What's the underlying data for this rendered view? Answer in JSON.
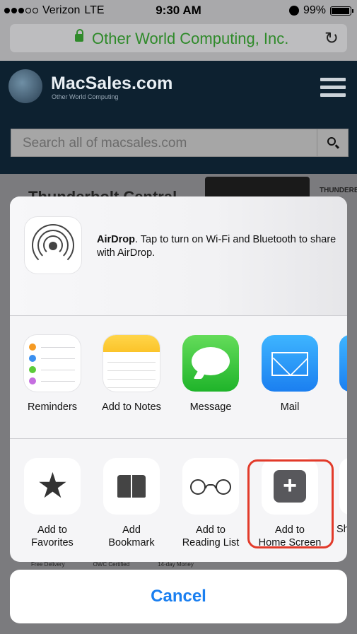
{
  "status_bar": {
    "carrier": "Verizon",
    "network": "LTE",
    "time": "9:30 AM",
    "battery": "99%",
    "battery_level": 0.99
  },
  "browser": {
    "url_title": "Other World Computing, Inc.",
    "reload_icon": "reload-icon",
    "lock_icon": "lock-icon"
  },
  "site": {
    "logo": "MacSales.com",
    "logo_sub": "Other World Computing",
    "search_placeholder": "Search all of macsales.com",
    "banner_partial": "Thunderbolt Central",
    "tb_badge": "THUNDERBO",
    "footer_items": [
      "Free Delivery",
      "OWC Certified",
      "14-day Money"
    ]
  },
  "share_sheet": {
    "airdrop": {
      "title": "AirDrop",
      "text": ". Tap to turn on Wi-Fi and Bluetooth to share with AirDrop."
    },
    "apps": [
      {
        "label": "Reminders",
        "icon": "reminders-icon"
      },
      {
        "label": "Add to Notes",
        "icon": "notes-icon"
      },
      {
        "label": "Message",
        "icon": "message-icon"
      },
      {
        "label": "Mail",
        "icon": "mail-icon"
      }
    ],
    "actions": [
      {
        "label_line1": "Add to",
        "label_line2": "Favorites",
        "icon": "star-icon"
      },
      {
        "label_line1": "Add",
        "label_line2": "Bookmark",
        "icon": "bookmark-icon"
      },
      {
        "label_line1": "Add to",
        "label_line2": "Reading List",
        "icon": "reading-list-icon"
      },
      {
        "label_line1": "Add to",
        "label_line2": "Home Screen",
        "icon": "add-home-screen-icon"
      }
    ],
    "partial_action_label": "Sh",
    "cancel_label": "Cancel"
  },
  "colors": {
    "accent": "#1a7ff0",
    "url_green": "#2f8a2a",
    "highlight_red": "#e23a2a"
  }
}
